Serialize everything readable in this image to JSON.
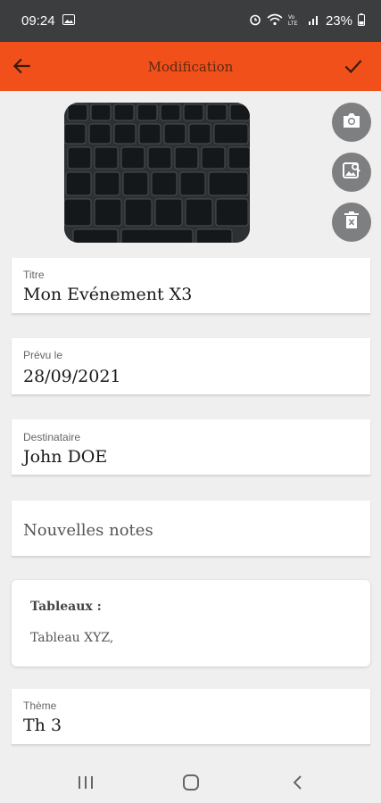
{
  "status_bar": {
    "time": "09:24",
    "battery": "23%",
    "icons": [
      "image-icon",
      "alarm-icon",
      "wifi-icon",
      "volte-icon",
      "signal-icon",
      "battery-icon"
    ]
  },
  "app_bar": {
    "title": "Modification",
    "background": "#f2501b",
    "left_icon": "arrow-back-icon",
    "right_icon": "check-icon"
  },
  "photo_actions": [
    "camera-icon",
    "image-search-icon",
    "delete-icon"
  ],
  "fields": {
    "title": {
      "label": "Titre",
      "value": "Mon Evénement X3"
    },
    "planned": {
      "label": "Prévu le",
      "value": "28/09/2021"
    },
    "recipient": {
      "label": "Destinataire",
      "value": "John DOE"
    },
    "notes": {
      "placeholder": "Nouvelles notes"
    },
    "theme": {
      "label": "Thème",
      "value": "Th 3"
    }
  },
  "boards": {
    "heading": "Tableaux :",
    "text": "Tableau XYZ,"
  },
  "nav_bar": [
    "recents-icon",
    "home-icon",
    "back-icon"
  ]
}
